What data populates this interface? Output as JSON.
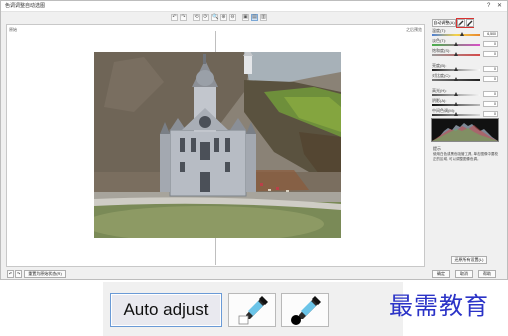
{
  "window": {
    "title": "色调调整自动选图",
    "help_glyph": "?",
    "close_glyph": "✕"
  },
  "toolbar": {
    "tools": [
      "↶",
      "↷",
      "⟲",
      "⟳",
      "🔍",
      "⊕",
      "⊖",
      "▣",
      "▤",
      "▥"
    ]
  },
  "preview": {
    "before_label": "原始",
    "after_label": "之后预览"
  },
  "panel": {
    "auto_adjust_label": "自动调整(A)",
    "sliders": [
      {
        "label": "温度(T):",
        "value": "6,500",
        "pos": 0.62,
        "gradient": "linear-gradient(90deg,#4d7fd6,#f4d24a,#e8872e)"
      },
      {
        "label": "淡色(T):",
        "value": "0",
        "pos": 0.5,
        "gradient": "linear-gradient(90deg,#48b04a,#d94fc7)"
      },
      {
        "label": "饱和度(S):",
        "value": "0",
        "pos": 0.5,
        "gradient": "linear-gradient(90deg,#9a9a9a,#d44a4a)"
      },
      {
        "label": "亮度(B):",
        "value": "0",
        "pos": 0.5,
        "gradient": "linear-gradient(90deg,#222,#fafafa)"
      },
      {
        "label": "对比度(C):",
        "value": "0",
        "pos": 0.5,
        "gradient": "linear-gradient(90deg,#777,#222)"
      },
      {
        "label": "高光(H):",
        "value": "0",
        "pos": 0.5,
        "gradient": "linear-gradient(90deg,#555,#f5f5f5)"
      },
      {
        "label": "阴影(A):",
        "value": "0",
        "pos": 0.5,
        "gradient": "linear-gradient(90deg,#111,#bbb)"
      },
      {
        "label": "中间色调(M):",
        "value": "0",
        "pos": 0.5,
        "gradient": "linear-gradient(90deg,#333,#dcdcdc)"
      }
    ],
    "tip_title": "提示",
    "tip_text": "使用白色或黑色吸管工具, 单击图像中要校正的区域, 可以调整图像色调。",
    "settings_button": "还原所有设置(L)"
  },
  "bottom": {
    "reset_button": "重置为原始状态(R)",
    "ok_button": "确定",
    "cancel_button": "取消",
    "help_button": "帮助"
  },
  "callout": {
    "auto_adjust_label": "Auto adjust"
  },
  "watermark": "最需教育",
  "colors": {
    "accent": "#d9302f",
    "watermark": "#2b33c7"
  }
}
